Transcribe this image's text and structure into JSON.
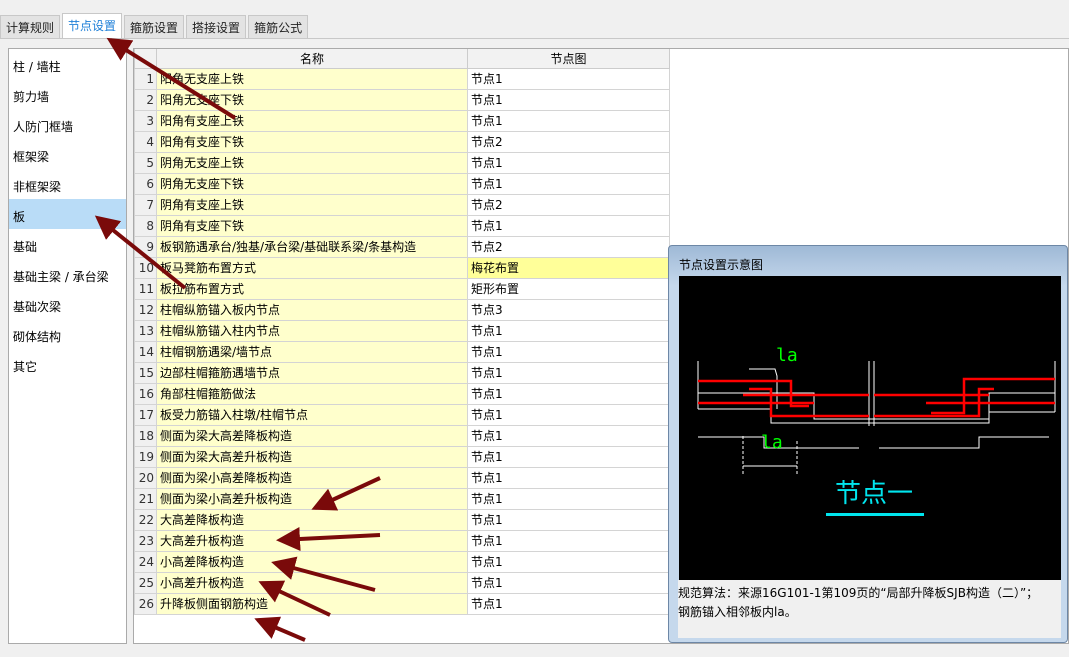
{
  "tabs": [
    "计算规则",
    "节点设置",
    "箍筋设置",
    "搭接设置",
    "箍筋公式"
  ],
  "active_tab": 1,
  "sidebar": [
    "柱 / 墙柱",
    "剪力墙",
    "人防门框墙",
    "框架梁",
    "非框架梁",
    "板",
    "基础",
    "基础主梁 / 承台梁",
    "基础次梁",
    "砌体结构",
    "其它"
  ],
  "sidebar_selected": 5,
  "table": {
    "headers": [
      "名称",
      "节点图"
    ],
    "rows": [
      [
        "1",
        "阳角无支座上铁",
        "节点1"
      ],
      [
        "2",
        "阳角无支座下铁",
        "节点1"
      ],
      [
        "3",
        "阳角有支座上铁",
        "节点1"
      ],
      [
        "4",
        "阳角有支座下铁",
        "节点2"
      ],
      [
        "5",
        "阴角无支座上铁",
        "节点1"
      ],
      [
        "6",
        "阴角无支座下铁",
        "节点1"
      ],
      [
        "7",
        "阴角有支座上铁",
        "节点2"
      ],
      [
        "8",
        "阴角有支座下铁",
        "节点1"
      ],
      [
        "9",
        "板钢筋遇承台/独基/承台梁/基础联系梁/条基构造",
        "节点2"
      ],
      [
        "10",
        "板马凳筋布置方式",
        "梅花布置"
      ],
      [
        "11",
        "板拉筋布置方式",
        "矩形布置"
      ],
      [
        "12",
        "柱帽纵筋锚入板内节点",
        "节点3"
      ],
      [
        "13",
        "柱帽纵筋锚入柱内节点",
        "节点1"
      ],
      [
        "14",
        "柱帽钢筋遇梁/墙节点",
        "节点1"
      ],
      [
        "15",
        "边部柱帽箍筋遇墙节点",
        "节点1"
      ],
      [
        "16",
        "角部柱帽箍筋做法",
        "节点1"
      ],
      [
        "17",
        "板受力筋锚入柱墩/柱帽节点",
        "节点1"
      ],
      [
        "18",
        "侧面为梁大高差降板构造",
        "节点1"
      ],
      [
        "19",
        "侧面为梁大高差升板构造",
        "节点1"
      ],
      [
        "20",
        "侧面为梁小高差降板构造",
        "节点1"
      ],
      [
        "21",
        "侧面为梁小高差升板构造",
        "节点1"
      ],
      [
        "22",
        "大高差降板构造",
        "节点1"
      ],
      [
        "23",
        "大高差升板构造",
        "节点1"
      ],
      [
        "24",
        "小高差降板构造",
        "节点1"
      ],
      [
        "25",
        "小高差升板构造",
        "节点1"
      ],
      [
        "26",
        "升降板侧面钢筋构造",
        "节点1"
      ]
    ],
    "selected_row": 9
  },
  "panel": {
    "title": "节点设置示意图",
    "diagram_label": "节点一",
    "dim_label": "la",
    "desc1": "规范算法：来源16G101-1第109页的“局部升降板SJB构造（二）”；",
    "desc2": "钢筋锚入相邻板内la。"
  },
  "colors": {
    "arrow": "#7a0a0a",
    "rebar": "#ff0000",
    "label": "#00e5ee",
    "dim": "#00ff00"
  }
}
